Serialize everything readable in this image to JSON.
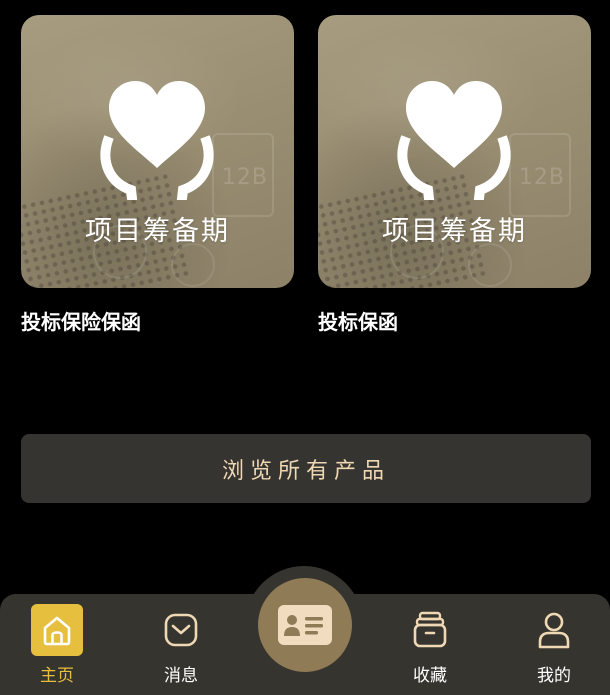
{
  "products": [
    {
      "image_caption": "项目筹备期",
      "image_deco_text": "12B",
      "title": "投标保险保函"
    },
    {
      "image_caption": "项目筹备期",
      "image_deco_text": "12B",
      "title": "投标保函"
    }
  ],
  "browse_button": {
    "label": "浏览所有产品"
  },
  "tab_bar": {
    "tabs": [
      {
        "label": "主页",
        "icon": "home-icon",
        "active": true
      },
      {
        "label": "消息",
        "icon": "message-icon",
        "active": false
      },
      {
        "label": "",
        "icon": "id-card-icon",
        "active": false
      },
      {
        "label": "收藏",
        "icon": "favorites-box-icon",
        "active": false
      },
      {
        "label": "我的",
        "icon": "user-icon",
        "active": false
      }
    ]
  },
  "colors": {
    "background": "#000000",
    "accent_gold": "#e7bf3f",
    "button_text": "#efd8b4",
    "tab_bar_bg": "#36342e",
    "center_button_bg": "#8f7b55"
  }
}
